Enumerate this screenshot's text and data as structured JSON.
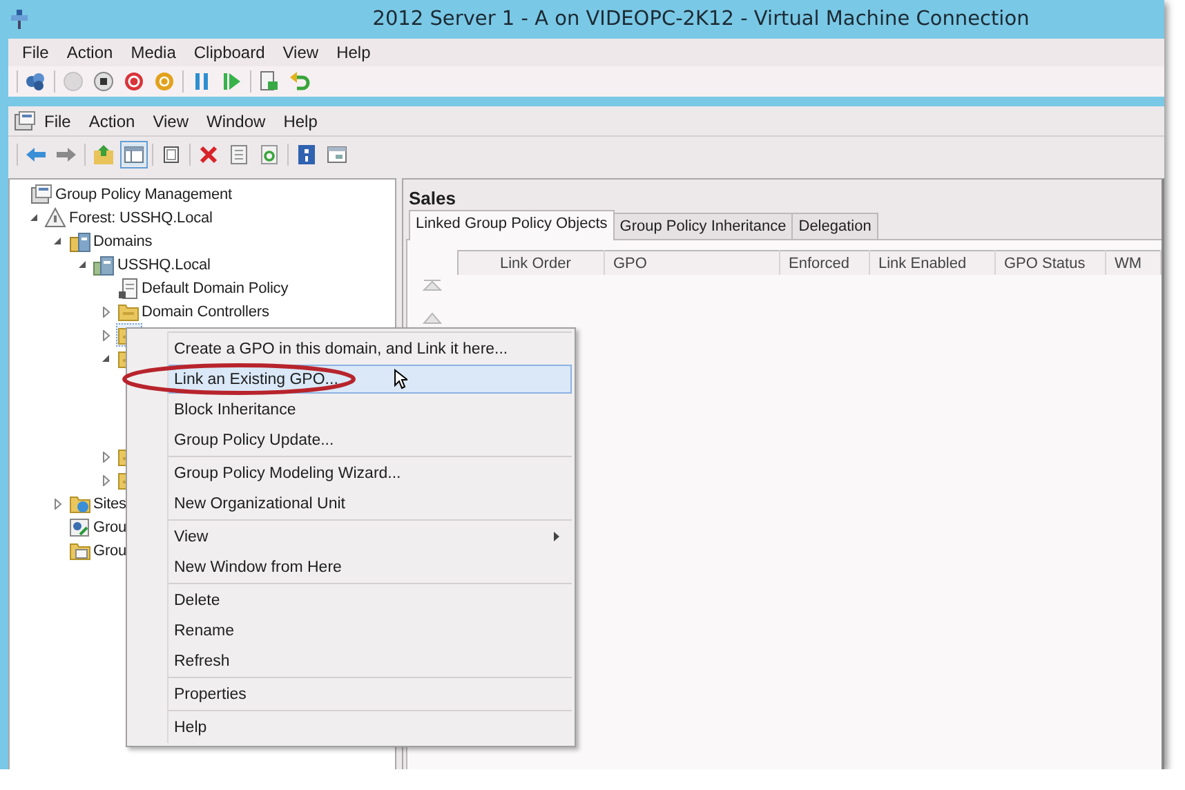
{
  "window": {
    "title": "2012 Server 1 - A on VIDEOPC-2K12 - Virtual Machine Connection"
  },
  "menu_bar": [
    "File",
    "Action",
    "Media",
    "Clipboard",
    "View",
    "Help"
  ],
  "toolbar": [
    [
      {
        "kind": "keyboard",
        "disabled": false
      }
    ],
    [
      {
        "kind": "start",
        "disabled": true
      },
      {
        "kind": "turn-off",
        "disabled": false
      },
      {
        "kind": "shut-down",
        "disabled": false
      },
      {
        "kind": "save",
        "disabled": false
      }
    ],
    [
      {
        "kind": "pause",
        "disabled": false
      },
      {
        "kind": "reset",
        "disabled": false
      }
    ],
    [
      {
        "kind": "snapshot",
        "disabled": false
      },
      {
        "kind": "revert",
        "disabled": false
      }
    ]
  ],
  "console": {
    "menu_bar": [
      "File",
      "Action",
      "View",
      "Window",
      "Help"
    ],
    "toolbar": [
      [
        {
          "kind": "back",
          "selected": false
        },
        {
          "kind": "forward",
          "selected": false
        }
      ],
      [
        {
          "kind": "up",
          "selected": false
        },
        {
          "kind": "tree-pane",
          "selected": true
        }
      ],
      [
        {
          "kind": "new-window",
          "selected": false
        }
      ],
      [
        {
          "kind": "delete",
          "selected": false
        },
        {
          "kind": "properties",
          "selected": false
        },
        {
          "kind": "refresh",
          "selected": false
        }
      ],
      [
        {
          "kind": "help",
          "selected": false
        },
        {
          "kind": "console",
          "selected": false
        }
      ]
    ]
  },
  "tree": {
    "label": "Group Policy Management",
    "kind": "console",
    "selected": false,
    "children": [
      {
        "label": "Forest: USSHQ.Local",
        "kind": "forest",
        "expanded": true,
        "selected": false,
        "children": [
          {
            "label": "Domains",
            "kind": "domains",
            "expanded": true,
            "selected": false,
            "children": [
              {
                "label": "USSHQ.Local",
                "kind": "domain",
                "expanded": true,
                "selected": false,
                "children": [
                  {
                    "label": "Default Domain Policy",
                    "kind": "gpo",
                    "selected": false
                  },
                  {
                    "label": "Domain Controllers",
                    "kind": "folder",
                    "expanded": false,
                    "selected": false
                  },
                  {
                    "kind": "folder",
                    "expanded": false,
                    "selected": true
                  },
                  {
                    "kind": "folder",
                    "expanded": true,
                    "selected": false
                  },
                  {
                    "kind": "folder",
                    "expanded": false,
                    "selected": false
                  },
                  {
                    "kind": "folder",
                    "expanded": false,
                    "selected": false
                  }
                ]
              }
            ]
          },
          {
            "label": "Sites",
            "kind": "sites",
            "expanded": false,
            "selected": false
          },
          {
            "label": "Grou",
            "kind": "modeling",
            "selected": false
          },
          {
            "label": "Grou",
            "kind": "results",
            "selected": false
          }
        ]
      }
    ]
  },
  "details": {
    "title": "Sales",
    "tabs": [
      {
        "label": "Linked Group Policy Objects",
        "selected": true
      },
      {
        "label": "Group Policy Inheritance",
        "selected": false
      },
      {
        "label": "Delegation",
        "selected": false
      }
    ],
    "table": {
      "columns": [
        "Link Order",
        "GPO",
        "Enforced",
        "Link Enabled",
        "GPO Status",
        "WM"
      ]
    }
  },
  "context_menu": {
    "groups": [
      [
        {
          "label": "Create a GPO in this domain, and Link it here...",
          "highlighted": false,
          "submenu": false
        },
        {
          "label": "Link an Existing GPO...",
          "highlighted": true,
          "submenu": false
        },
        {
          "label": "Block Inheritance",
          "highlighted": false,
          "submenu": false
        },
        {
          "label": "Group Policy Update...",
          "highlighted": false,
          "submenu": false
        }
      ],
      [
        {
          "label": "Group Policy Modeling Wizard...",
          "highlighted": false,
          "submenu": false
        },
        {
          "label": "New Organizational Unit",
          "highlighted": false,
          "submenu": false
        }
      ],
      [
        {
          "label": "View",
          "highlighted": false,
          "submenu": true
        },
        {
          "label": "New Window from Here",
          "highlighted": false,
          "submenu": false
        }
      ],
      [
        {
          "label": "Delete",
          "highlighted": false,
          "submenu": false
        },
        {
          "label": "Rename",
          "highlighted": false,
          "submenu": false
        },
        {
          "label": "Refresh",
          "highlighted": false,
          "submenu": false
        }
      ],
      [
        {
          "label": "Properties",
          "highlighted": false,
          "submenu": false
        }
      ],
      [
        {
          "label": "Help",
          "highlighted": false,
          "submenu": false
        }
      ]
    ]
  }
}
